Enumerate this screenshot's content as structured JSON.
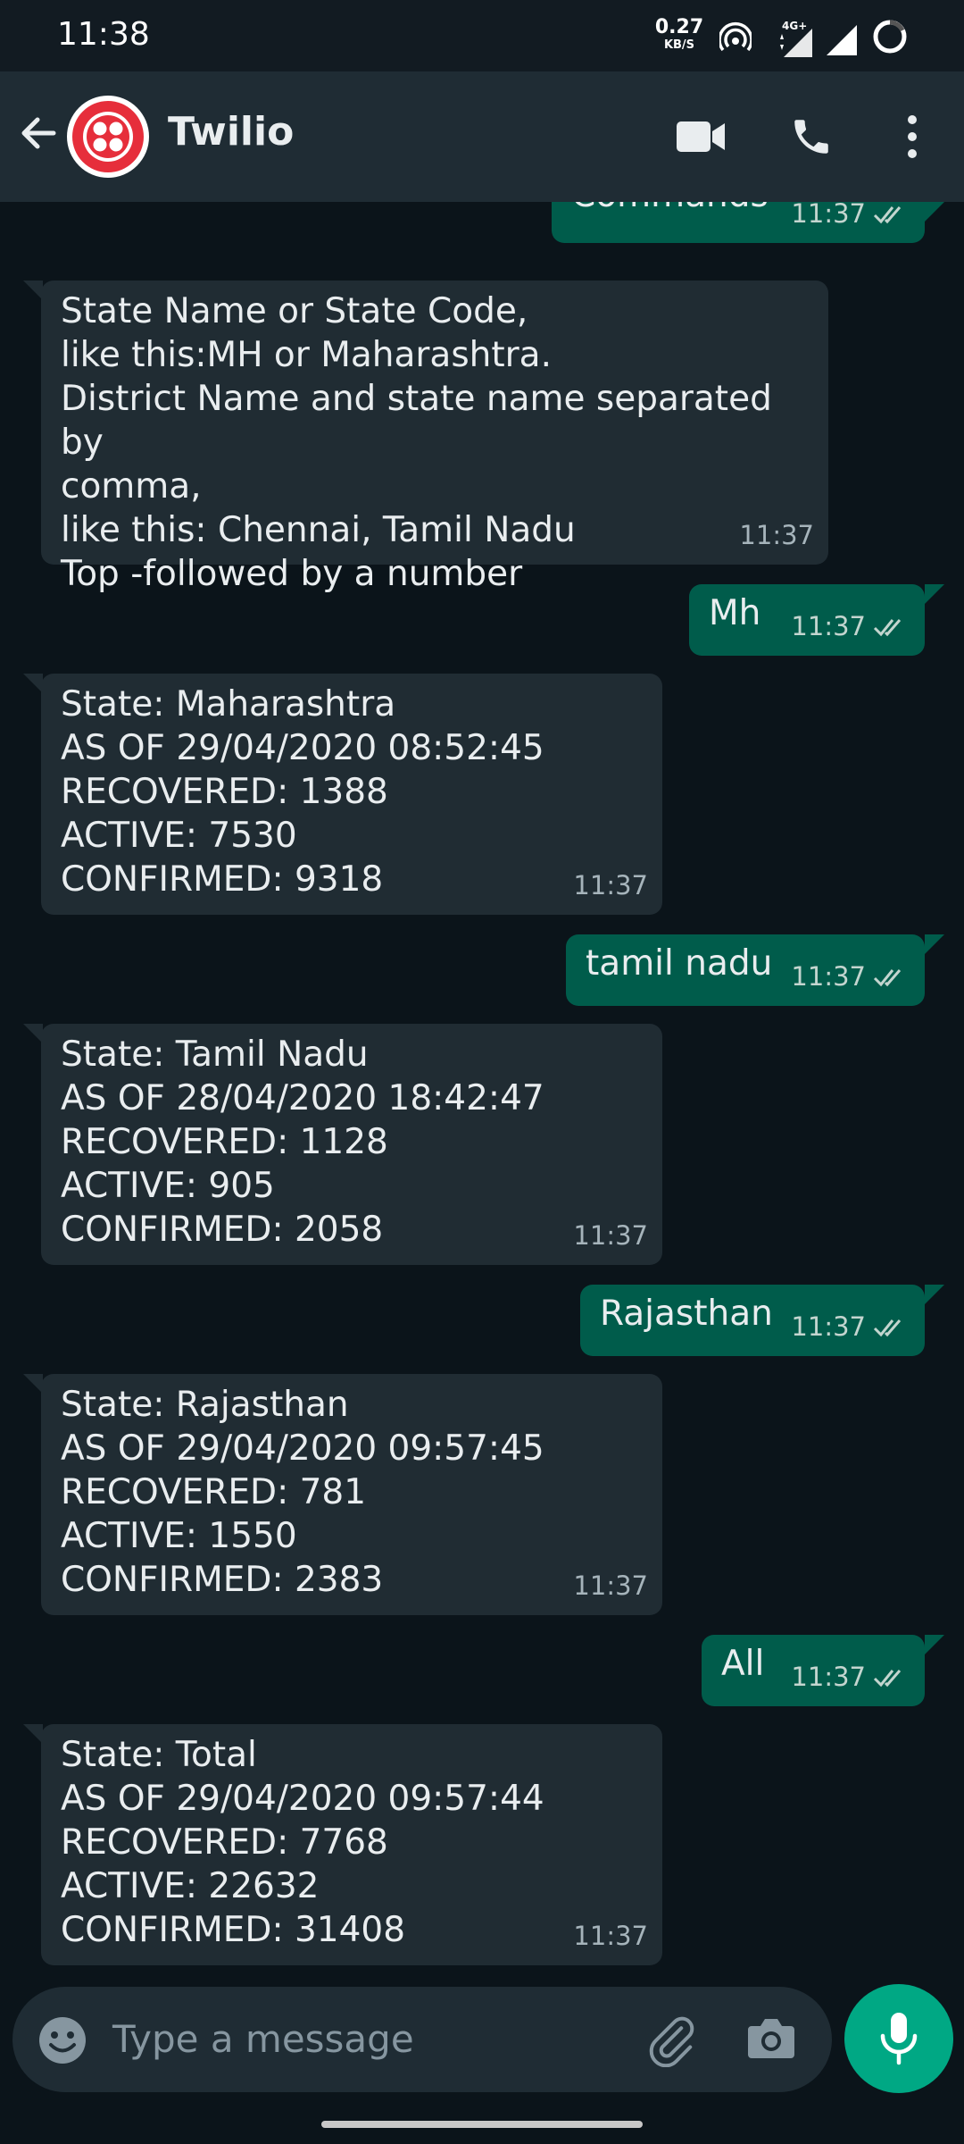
{
  "status_bar": {
    "time": "11:38",
    "net_speed": "0.27",
    "net_unit": "KB/S",
    "network_type": "4G+",
    "icons": [
      "hotspot-icon",
      "signal-4g-icon",
      "signal-icon",
      "battery-ring-icon"
    ]
  },
  "header": {
    "title": "Twilio",
    "avatar": "twilio-logo",
    "icons": [
      "back-arrow-icon",
      "video-call-icon",
      "voice-call-icon",
      "more-options-icon"
    ]
  },
  "messages": [
    {
      "dir": "out",
      "text": "Commands",
      "time": "11:37",
      "ticks": "read"
    },
    {
      "dir": "in",
      "lines": [
        "State Name or State Code,",
        "like this:MH or Maharashtra.",
        "District Name and state name separated by",
        "comma,",
        "like this: Chennai, Tamil Nadu",
        "Top -followed by a number"
      ],
      "time": "11:37"
    },
    {
      "dir": "out",
      "text": "Mh",
      "time": "11:37",
      "ticks": "read"
    },
    {
      "dir": "in",
      "lines": [
        "State: Maharashtra",
        "AS OF 29/04/2020 08:52:45",
        "RECOVERED: 1388",
        "ACTIVE: 7530",
        "CONFIRMED: 9318"
      ],
      "time": "11:37"
    },
    {
      "dir": "out",
      "text": "tamil nadu",
      "time": "11:37",
      "ticks": "read"
    },
    {
      "dir": "in",
      "lines": [
        "State: Tamil Nadu",
        "AS OF 28/04/2020 18:42:47",
        "RECOVERED: 1128",
        "ACTIVE: 905",
        "CONFIRMED: 2058"
      ],
      "time": "11:37"
    },
    {
      "dir": "out",
      "text": "Rajasthan",
      "time": "11:37",
      "ticks": "read"
    },
    {
      "dir": "in",
      "lines": [
        "State: Rajasthan",
        "AS OF 29/04/2020 09:57:45",
        "RECOVERED: 781",
        "ACTIVE: 1550",
        "CONFIRMED: 2383"
      ],
      "time": "11:37"
    },
    {
      "dir": "out",
      "text": "All",
      "time": "11:37",
      "ticks": "read"
    },
    {
      "dir": "in",
      "lines": [
        "State: Total",
        "AS OF 29/04/2020 09:57:44",
        "RECOVERED: 7768",
        "ACTIVE: 22632",
        "CONFIRMED: 31408"
      ],
      "time": "11:37"
    }
  ],
  "composer": {
    "placeholder": "Type a message",
    "icons": [
      "emoji-icon",
      "attach-icon",
      "camera-icon",
      "mic-icon"
    ]
  },
  "colors": {
    "background": "#0b141a",
    "header": "#1f2c34",
    "incoming_bubble": "#202c33",
    "outgoing_bubble": "#005c4b",
    "accent": "#00a884",
    "read_tick": "#c3d5cf",
    "twilio_red": "#e62e3b"
  }
}
